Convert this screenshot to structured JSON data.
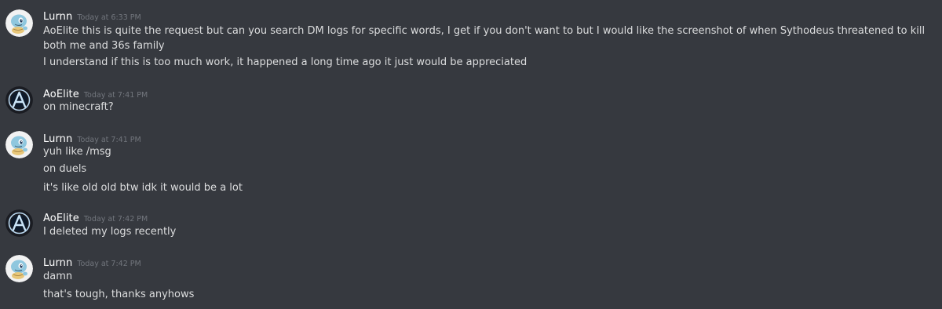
{
  "colors": {
    "background": "#36393f",
    "username": "#ffffff",
    "timestamp": "#72767d",
    "message_text": "#dcddde"
  },
  "messages": [
    {
      "username": "Lurnn",
      "timestamp": "Today at 6:33 PM",
      "avatar_icon": "squirtle-avatar-icon",
      "lines": [
        "AoElite this is quite the request but can you search DM logs for specific words, I get if you don't want to but I would like the screenshot of when Sythodeus threatened to kill both me and 36s family",
        "I understand if this is too much work, it happened a long time ago it just would be appreciated"
      ]
    },
    {
      "username": "AoElite",
      "timestamp": "Today at 7:41 PM",
      "avatar_icon": "dark-a-logo-avatar-icon",
      "lines": [
        "on minecraft?"
      ]
    },
    {
      "username": "Lurnn",
      "timestamp": "Today at 7:41 PM",
      "avatar_icon": "squirtle-avatar-icon",
      "lines": [
        "yuh like /msg",
        "on duels",
        "it's like old old btw idk it would be a lot"
      ]
    },
    {
      "username": "AoElite",
      "timestamp": "Today at 7:42 PM",
      "avatar_icon": "dark-a-logo-avatar-icon",
      "lines": [
        "I deleted my logs recently"
      ]
    },
    {
      "username": "Lurnn",
      "timestamp": "Today at 7:42 PM",
      "avatar_icon": "squirtle-avatar-icon",
      "lines": [
        "damn",
        "that's tough, thanks anyhows"
      ]
    }
  ]
}
